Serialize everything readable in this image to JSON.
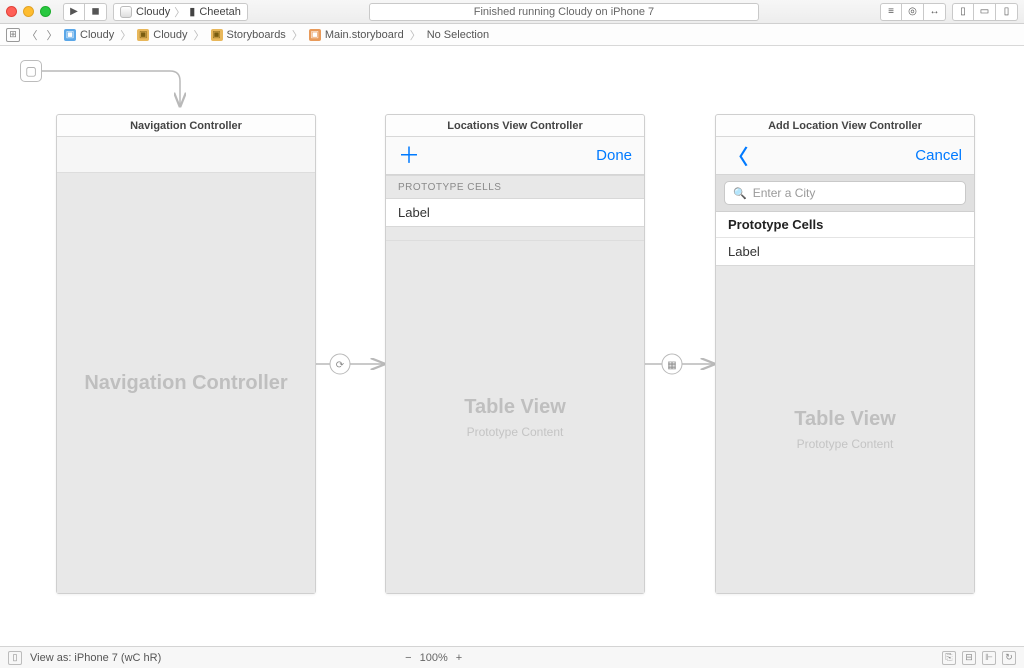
{
  "toolbar": {
    "scheme_app": "Cloudy",
    "scheme_device": "Cheetah",
    "status_text": "Finished running Cloudy on iPhone 7"
  },
  "jumpbar": {
    "items": [
      "Cloudy",
      "Cloudy",
      "Storyboards",
      "Main.storyboard",
      "No Selection"
    ]
  },
  "scenes": {
    "nav": {
      "title": "Navigation Controller",
      "center_label": "Navigation Controller"
    },
    "locations": {
      "title": "Locations View Controller",
      "navbar_right": "Done",
      "prototype_header": "PROTOTYPE CELLS",
      "cell_label": "Label",
      "tableview_title": "Table View",
      "tableview_subtitle": "Prototype Content"
    },
    "add_location": {
      "title": "Add Location View Controller",
      "navbar_right": "Cancel",
      "search_placeholder": "Enter a City",
      "section_header": "Prototype Cells",
      "cell_label": "Label",
      "tableview_title": "Table View",
      "tableview_subtitle": "Prototype Content"
    }
  },
  "bottom": {
    "view_as": "View as: iPhone 7 (wC hR)",
    "zoom_percent": "100%"
  }
}
